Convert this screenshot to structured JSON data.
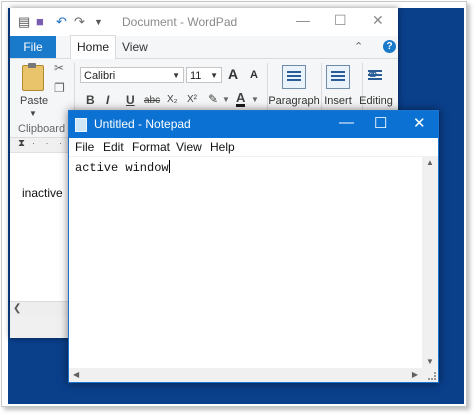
{
  "wordpad": {
    "title": "Document - WordPad",
    "tabs": {
      "file": "File",
      "home": "Home",
      "view": "View"
    },
    "help": "?",
    "paste_label": "Paste",
    "clipboard_label": "Clipboard",
    "font_name": "Calibri",
    "font_size": "11",
    "grow_font": "A",
    "shrink_font": "A",
    "format_buttons": [
      "B",
      "I",
      "U",
      "abc",
      "X₂",
      "X²"
    ],
    "font_color": "A",
    "groups": {
      "paragraph": "Paragraph",
      "insert": "Insert",
      "editing": "Editing"
    },
    "doc_text": "inactive",
    "caption": {
      "min": "—",
      "max": "☐",
      "close": "✕"
    }
  },
  "notepad": {
    "title": "Untitled - Notepad",
    "menu": [
      "File",
      "Edit",
      "Format",
      "View",
      "Help"
    ],
    "content": "active window",
    "caption": {
      "min": "—",
      "max": "☐",
      "close": "✕"
    }
  },
  "colors": {
    "desktop": "#0a3f8a",
    "notepad_titlebar": "#0b72d3",
    "wordpad_file_tab": "#1979ca"
  }
}
